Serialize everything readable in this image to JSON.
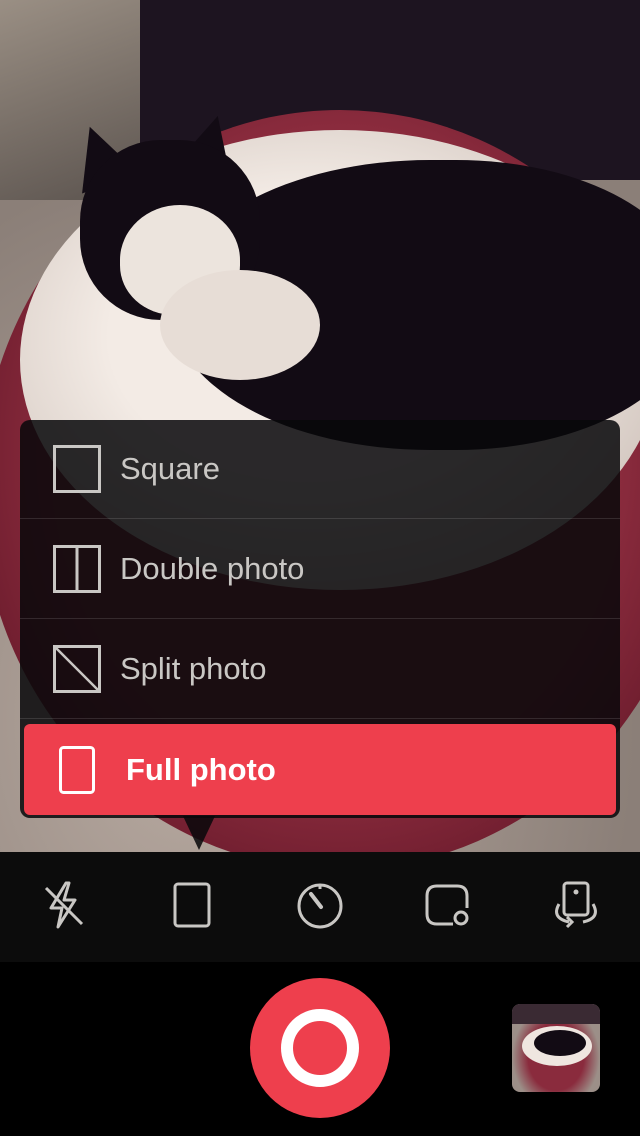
{
  "menu": {
    "items": [
      {
        "label": "Square",
        "icon": "square-format-icon"
      },
      {
        "label": "Double photo",
        "icon": "double-photo-icon"
      },
      {
        "label": "Split photo",
        "icon": "split-photo-icon"
      },
      {
        "label": "Full photo",
        "icon": "full-photo-icon",
        "selected": true
      }
    ]
  },
  "toolbar": {
    "icons": [
      "flash-off-icon",
      "format-icon",
      "timer-icon",
      "shape-icon",
      "switch-camera-icon"
    ]
  },
  "colors": {
    "accent": "#ee3f4d",
    "menu_bg": "#08080a",
    "toolbar_bg": "#0c0c0c",
    "icon": "#c9c7c4"
  }
}
